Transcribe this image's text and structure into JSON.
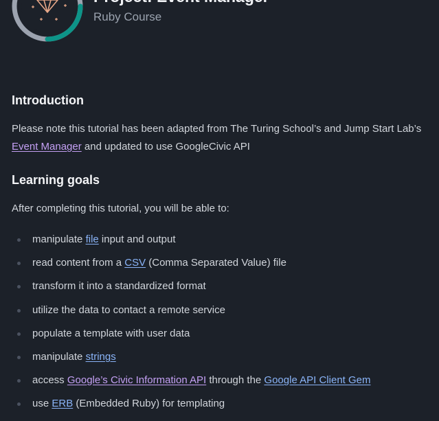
{
  "header": {
    "badge_icon": "gem-icon",
    "title": "Project: Event Manager",
    "course": "Ruby Course"
  },
  "colors": {
    "background": "#1c2129",
    "accent": "#0d9488",
    "ring_track": "#9ca3af",
    "link": "#8ab4f8",
    "visited_link": "#c4a0f4"
  },
  "introduction": {
    "heading": "Introduction",
    "text_before": "Please note this tutorial has been adapted from The Turing School’s and Jump Start Lab’s ",
    "link": "Event Manager",
    "text_after": " and updated to use GoogleCivic API"
  },
  "learning_goals": {
    "heading": "Learning goals",
    "lead": "After completing this tutorial, you will be able to:",
    "items": [
      {
        "pre": "manipulate ",
        "link": "file",
        "post": " input and output"
      },
      {
        "pre": "read content from a ",
        "link": "CSV",
        "post": " (Comma Separated Value) file"
      },
      {
        "text": "transform it into a standardized format"
      },
      {
        "text": "utilize the data to contact a remote service"
      },
      {
        "text": "populate a template with user data"
      },
      {
        "pre": "manipulate ",
        "link": "strings",
        "post": ""
      },
      {
        "pre": "access ",
        "link": "Google’s Civic Information API",
        "mid": " through the ",
        "link2": "Google API Client Gem",
        "post": ""
      },
      {
        "pre": "use ",
        "link": "ERB",
        "post": " (Embedded Ruby) for templating"
      }
    ]
  }
}
